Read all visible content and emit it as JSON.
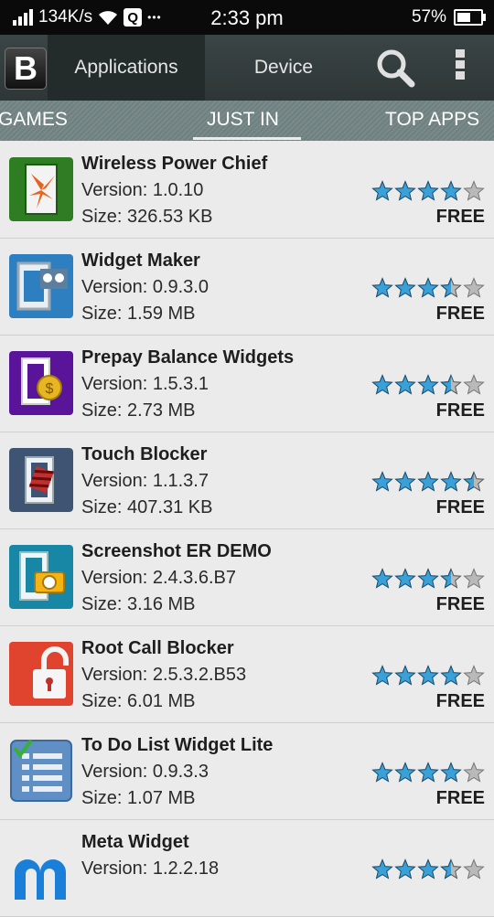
{
  "status_bar": {
    "speed": "134K/s",
    "q_badge": "Q",
    "dots": "•••",
    "time": "2:33 pm",
    "battery_text": "57%",
    "battery_level": 0.57
  },
  "top_bar": {
    "logo": "B",
    "tab_apps": "Applications",
    "tab_device": "Device"
  },
  "categories": {
    "games": "GAMES",
    "just_in": "JUST IN",
    "top_apps": "TOP APPS"
  },
  "apps": [
    {
      "name": "Wireless Power Chief",
      "version": "Version: 1.0.10",
      "size": "Size: 326.53 KB",
      "rating": 4,
      "price": "FREE",
      "icon": "wireless-power-icon"
    },
    {
      "name": "Widget Maker",
      "version": "Version: 0.9.3.0",
      "size": "Size: 1.59 MB",
      "rating": 3.5,
      "price": "FREE",
      "icon": "widget-maker-icon"
    },
    {
      "name": "Prepay Balance Widgets",
      "version": "Version: 1.5.3.1",
      "size": "Size: 2.73 MB",
      "rating": 3.5,
      "price": "FREE",
      "icon": "prepay-balance-icon"
    },
    {
      "name": "Touch Blocker",
      "version": "Version: 1.1.3.7",
      "size": "Size: 407.31 KB",
      "rating": 4.5,
      "price": "FREE",
      "icon": "touch-blocker-icon"
    },
    {
      "name": "Screenshot ER DEMO",
      "version": "Version: 2.4.3.6.B7",
      "size": "Size: 3.16 MB",
      "rating": 3.5,
      "price": "FREE",
      "icon": "screenshot-er-icon"
    },
    {
      "name": "Root Call Blocker",
      "version": "Version: 2.5.3.2.B53",
      "size": "Size: 6.01 MB",
      "rating": 4,
      "price": "FREE",
      "icon": "root-call-blocker-icon"
    },
    {
      "name": "To Do List Widget Lite",
      "version": "Version: 0.9.3.3",
      "size": "Size: 1.07 MB",
      "rating": 4,
      "price": "FREE",
      "icon": "todo-list-icon"
    },
    {
      "name": "Meta Widget",
      "version": "Version: 1.2.2.18",
      "size": "",
      "rating": 3.5,
      "price": "",
      "icon": "meta-widget-icon"
    }
  ],
  "colors": {
    "star_fill": "#3aa0d8",
    "star_empty": "#b9b9b9",
    "topbar": "#323b3b",
    "catbar": "#758585"
  }
}
